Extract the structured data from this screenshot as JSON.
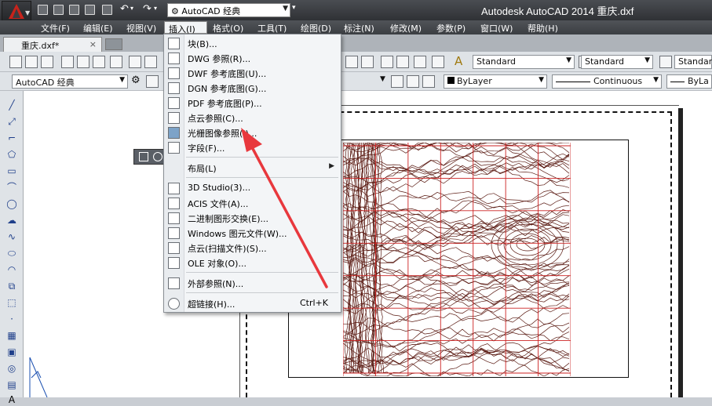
{
  "app_title": "Autodesk AutoCAD 2014    重庆.dxf",
  "workspace": "AutoCAD 经典",
  "menubar": [
    "文件(F)",
    "编辑(E)",
    "视图(V)",
    "插入(I)",
    "格式(O)",
    "工具(T)",
    "绘图(D)",
    "标注(N)",
    "修改(M)",
    "参数(P)",
    "窗口(W)",
    "帮助(H)"
  ],
  "tab": {
    "title": "重庆.dxf*",
    "close": "×"
  },
  "toolbar": {
    "text_style": "Standard",
    "dim_style": "Standard",
    "table_style": "Standard",
    "workspace_combo": "AutoCAD 经典",
    "color": "ByLayer",
    "linetype": "Continuous",
    "lineweight": "ByLa"
  },
  "insert_menu": [
    {
      "label": "块(B)...",
      "icon": "block-icon"
    },
    {
      "label": "DWG 参照(R)...",
      "icon": "dwg-reference-icon"
    },
    {
      "label": "DWF 参考底图(U)...",
      "icon": "dwf-underlay-icon"
    },
    {
      "label": "DGN 参考底图(G)...",
      "icon": "dgn-underlay-icon"
    },
    {
      "label": "PDF 参考底图(P)...",
      "icon": "pdf-underlay-icon"
    },
    {
      "label": "点云参照(C)...",
      "icon": "point-cloud-icon"
    },
    {
      "label": "光栅图像参照(I)...",
      "icon": "raster-image-icon"
    },
    {
      "label": "字段(F)...",
      "icon": "field-icon"
    },
    {
      "label": "布局(L)",
      "icon": "",
      "submenu": true
    },
    {
      "label": "3D Studio(3)...",
      "icon": "import-3ds-icon"
    },
    {
      "label": "ACIS 文件(A)...",
      "icon": "import-acis-icon"
    },
    {
      "label": "二进制图形交换(E)...",
      "icon": "import-dxb-icon"
    },
    {
      "label": "Windows 图元文件(W)...",
      "icon": "import-wmf-icon"
    },
    {
      "label": "点云(扫描文件)(S)...",
      "icon": "point-cloud-scan-icon"
    },
    {
      "label": "OLE 对象(O)...",
      "icon": "ole-object-icon"
    },
    {
      "label": "外部参照(N)...",
      "icon": "external-reference-icon"
    },
    {
      "label": "超链接(H)...",
      "icon": "hyperlink-icon",
      "shortcut": "Ctrl+K"
    }
  ],
  "colors": {
    "accent_arrow": "#e8383d",
    "grid": "#cc2222",
    "contour": "#5a1a12"
  }
}
